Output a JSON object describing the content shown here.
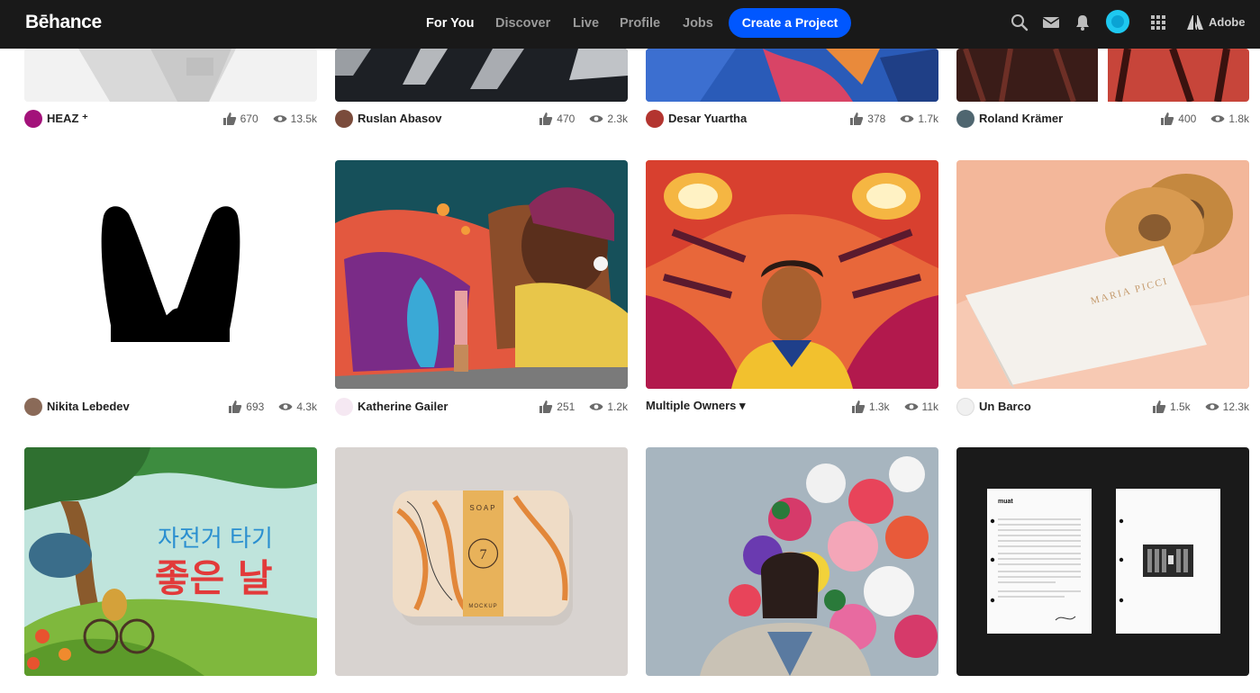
{
  "header": {
    "logo": "Bēhance",
    "nav": [
      "For You",
      "Discover",
      "Live",
      "Profile",
      "Jobs"
    ],
    "create_label": "Create a Project",
    "adobe_label": "Adobe",
    "icons": [
      "search-icon",
      "mail-icon",
      "bell-icon",
      "avatar",
      "apps-grid-icon",
      "adobe-logo-icon"
    ]
  },
  "rows": [
    [
      {
        "owner": "HEAZ ⁺",
        "likes": "670",
        "views": "13.5k"
      },
      {
        "owner": "Ruslan Abasov",
        "likes": "470",
        "views": "2.3k"
      },
      {
        "owner": "Desar Yuartha",
        "likes": "378",
        "views": "1.7k"
      },
      {
        "owner": "Roland Krämer",
        "likes": "400",
        "views": "1.8k"
      }
    ],
    [
      {
        "owner": "Nikita Lebedev",
        "likes": "693",
        "views": "4.3k"
      },
      {
        "owner": "Katherine Gailer",
        "likes": "251",
        "views": "1.2k"
      },
      {
        "owner": "Multiple Owners ▾",
        "likes": "1.3k",
        "views": "11k"
      },
      {
        "owner": "Un Barco",
        "likes": "1.5k",
        "views": "12.3k"
      }
    ]
  ],
  "artwork_text": {
    "korean_line1": "자전거 타기",
    "korean_line2": "좋은 날",
    "soap_top": "SOAP",
    "soap_number": "7",
    "soap_bottom": "MOCKUP",
    "box_brand": "MARIA PICCI",
    "muat_title": "muat"
  },
  "colors": {
    "topbar": "#191919",
    "accent": "#0057ff"
  }
}
